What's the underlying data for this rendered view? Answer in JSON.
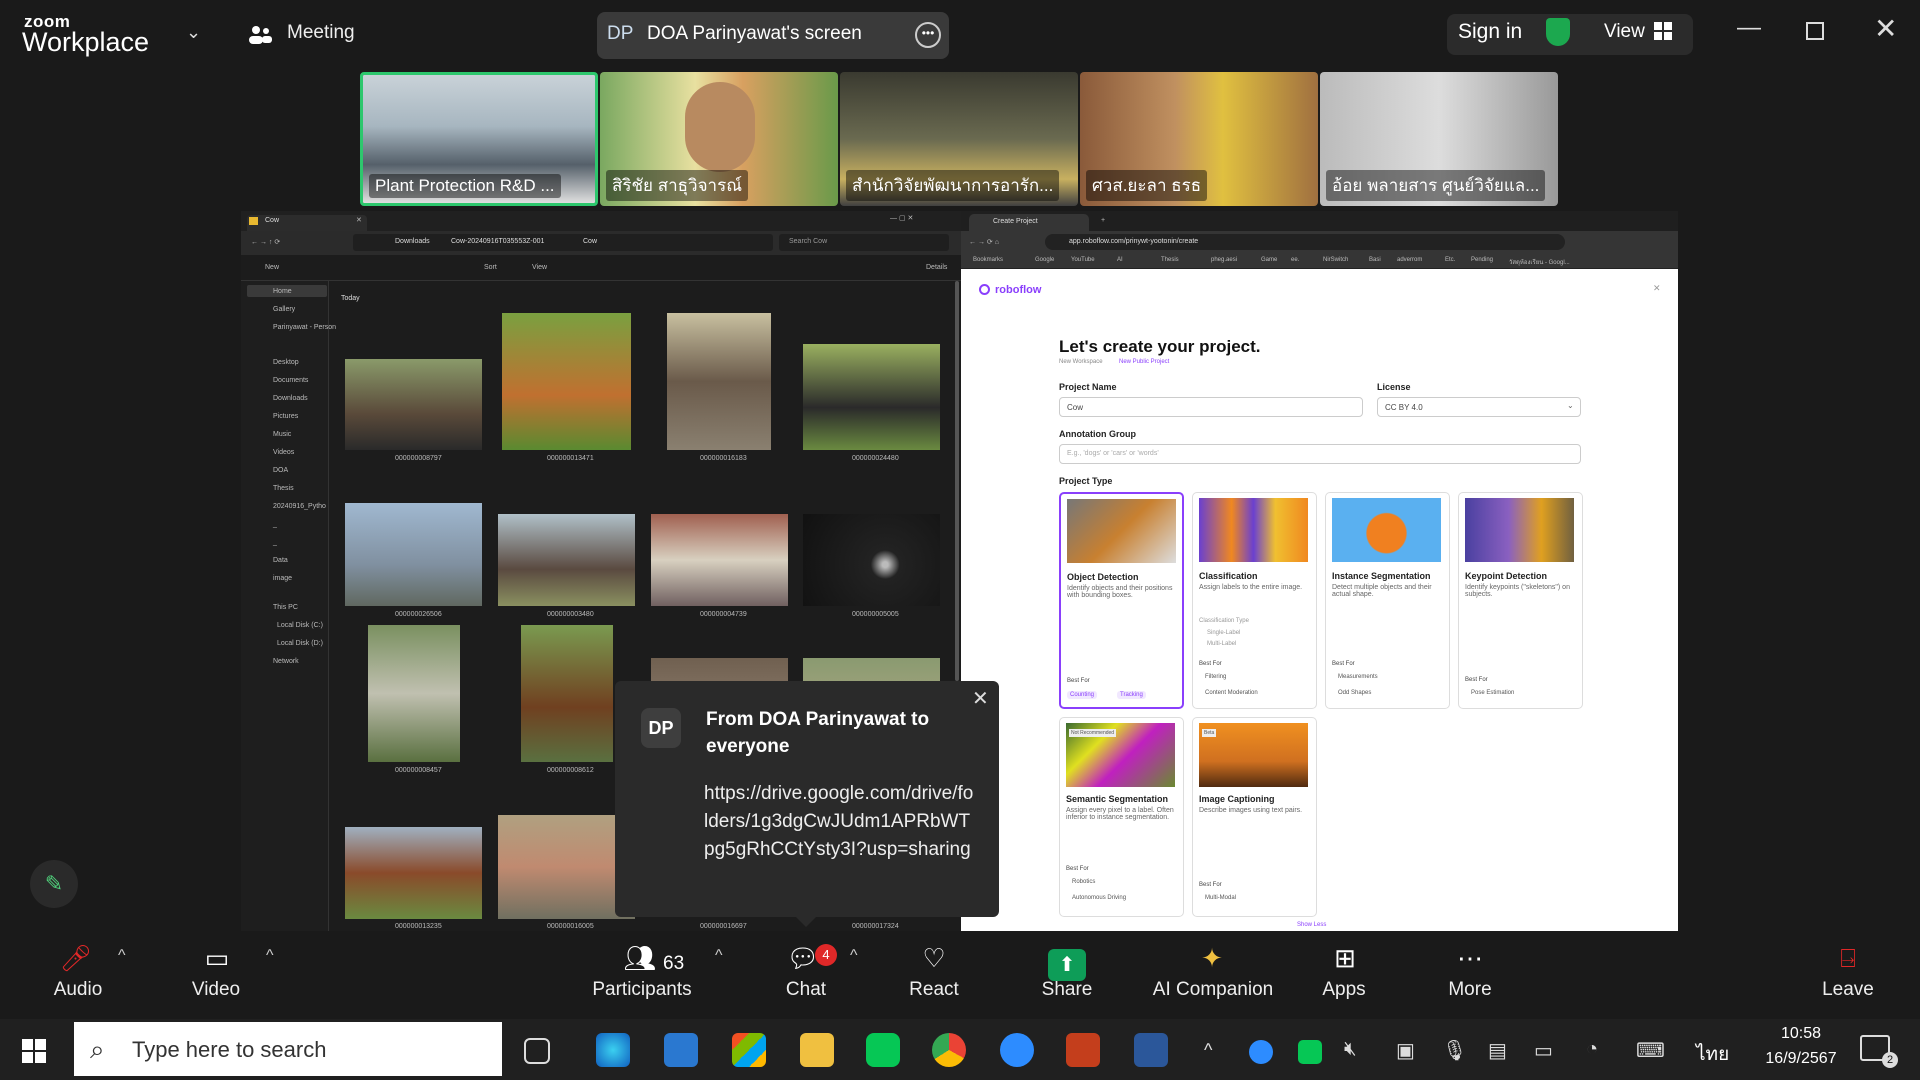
{
  "app": {
    "brand_top": "zoom",
    "brand_bottom": "Workplace",
    "meeting_label": "Meeting"
  },
  "share": {
    "initials": "DP",
    "label": "DOA Parinyawat's screen"
  },
  "header": {
    "sign_in": "Sign in",
    "view": "View"
  },
  "participants_strip": [
    {
      "name": "Plant Protection R&D ...",
      "color": "#8aa0b0"
    },
    {
      "name": "สิริชัย สาธุวิจารณ์",
      "color": "#4f7a3a"
    },
    {
      "name": "สำนักวิจัยพัฒนาการอารัก...",
      "color": "#555"
    },
    {
      "name": "ศวส.ยะลา ธรธ",
      "color": "#c9a040"
    },
    {
      "name": "อ้อย พลายสาร ศูนย์วิจัยแล...",
      "color": "#999"
    }
  ],
  "explorer": {
    "tab": "Cow",
    "breadcrumb": [
      "Downloads",
      "Cow-20240916T035553Z-001",
      "Cow"
    ],
    "search_placeholder": "Search Cow",
    "toolbar": [
      "New",
      "Sort",
      "View",
      "Details"
    ],
    "group": "Today",
    "nav": [
      "Home",
      "Gallery",
      "Parinyawat - Person",
      "Desktop",
      "Documents",
      "Downloads",
      "Pictures",
      "Music",
      "Videos",
      "DOA",
      "Thesis",
      "20240916_Pytho",
      "_",
      "_",
      "Data",
      "image",
      "This PC",
      "Local Disk (C:)",
      "Local Disk (D:)",
      "Network"
    ],
    "files": [
      "000000008797",
      "000000013471",
      "000000016183",
      "000000024480",
      "000000026506",
      "000000003480",
      "000000004739",
      "000000005005",
      "000000008457",
      "000000008612",
      "",
      "",
      "000000013235",
      "000000016005",
      "000000016697",
      "000000017324"
    ]
  },
  "browser": {
    "tab": "Create Project",
    "url": "app.roboflow.com/prinywt-yootonin/create",
    "bookmarks": [
      "Bookmarks",
      "Google",
      "YouTube",
      "AI",
      "Thesis",
      "pheg.aesi",
      "Game",
      "ee.",
      "NirSwitch",
      "Basi",
      "adverrom",
      "Etc.",
      "Pending",
      "วัสดุห้องเรียน - Googl..."
    ],
    "brand": "roboflow",
    "title": "Let's create your project.",
    "crumb_a": "New Workspace",
    "crumb_b": "New Public Project",
    "project_name_label": "Project Name",
    "project_name_value": "Cow",
    "license_label": "License",
    "license_value": "CC BY 4.0",
    "annotation_label": "Annotation Group",
    "annotation_placeholder": "E.g., 'dogs' or 'cars' or 'words'",
    "project_type_label": "Project Type",
    "types": [
      {
        "title": "Object Detection",
        "desc": "Identify objects and their positions with bounding boxes.",
        "best": "Best For",
        "tags": [
          "Counting",
          "Tracking"
        ]
      },
      {
        "title": "Classification",
        "desc": "Assign labels to the entire image.",
        "best": "Best For",
        "tags": [
          "Filtering",
          "Content Moderation"
        ],
        "extra": "Classification Type",
        "opt1": "Single-Label",
        "opt2": "Multi-Label"
      },
      {
        "title": "Instance Segmentation",
        "desc": "Detect multiple objects and their actual shape.",
        "best": "Best For",
        "tags": [
          "Measurements",
          "Odd Shapes"
        ]
      },
      {
        "title": "Keypoint Detection",
        "desc": "Identify keypoints (\"skeletons\") on subjects.",
        "best": "Best For",
        "tags": [
          "Pose Estimation"
        ]
      },
      {
        "title": "Semantic Segmentation",
        "desc": "Assign every pixel to a label. Often inferior to instance segmentation.",
        "best": "Best For",
        "tags": [
          "Robotics",
          "Autonomous Driving"
        ],
        "badge": "Not Recommended"
      },
      {
        "title": "Image Captioning",
        "desc": "Describe images using text pairs.",
        "best": "Best For",
        "tags": [
          "Multi-Modal"
        ],
        "badge": "Beta"
      }
    ],
    "show_less": "Show Less"
  },
  "toast": {
    "initials": "DP",
    "title": "From DOA Parinyawat to everyone",
    "message": "https://drive.google.com/drive/folders/1g3dgCwJUdm1APRbWTpg5gRhCCtYsty3I?usp=sharing"
  },
  "toolbar": {
    "audio": "Audio",
    "video": "Video",
    "participants": "Participants",
    "participants_count": "63",
    "chat": "Chat",
    "chat_badge": "4",
    "react": "React",
    "share": "Share",
    "ai": "AI Companion",
    "apps": "Apps",
    "more": "More",
    "leave": "Leave"
  },
  "taskbar": {
    "search_placeholder": "Type here to search",
    "lang": "ไทย",
    "time": "10:58",
    "date": "16/9/2567",
    "notif": "2"
  },
  "colors": {
    "accent_green": "#1ca84f",
    "roboflow_purple": "#8a3ffc",
    "share_green": "#0e9d58"
  }
}
